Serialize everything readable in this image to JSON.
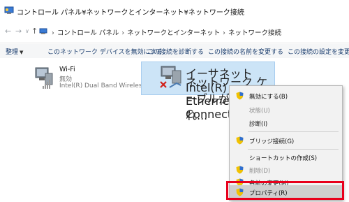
{
  "window": {
    "title": "コントロール パネル¥ネットワークとインターネット¥ネットワーク接続"
  },
  "nav": {
    "back": "←",
    "forward": "→",
    "recent": "∨",
    "up": "↑",
    "breadcrumbs": [
      "コントロール パネル",
      "ネットワークとインターネット",
      "ネットワーク接続"
    ],
    "separator": "›"
  },
  "toolbar": {
    "organize": "整理",
    "organize_caret": "▼",
    "disable": "このネットワーク デバイスを無効にする",
    "diagnose": "この接続を診断する",
    "rename": "この接続の名前を変更する",
    "settings": "この接続の設定を変更する"
  },
  "adapters": [
    {
      "name": "Wi-Fi",
      "status": "無効",
      "device": "Intel(R) Dual Band Wireless..."
    },
    {
      "name": "イーサネット",
      "status": "ネットワーク ケーブルが接続され...",
      "device": "Intel(R) Ethernet Connection..."
    }
  ],
  "context_menu": {
    "items": [
      {
        "label": "無効にする(B)",
        "shield": true,
        "disabled": false
      },
      {
        "label": "状態(U)",
        "shield": false,
        "disabled": true
      },
      {
        "label": "診断(I)",
        "shield": false,
        "disabled": false
      },
      {
        "label": "ブリッジ接続(G)",
        "shield": true,
        "disabled": false
      },
      {
        "label": "ショートカットの作成(S)",
        "shield": false,
        "disabled": false
      },
      {
        "label": "削除(D)",
        "shield": true,
        "disabled": true
      },
      {
        "label": "名前の変更(M)",
        "shield": true,
        "disabled": false
      },
      {
        "label": "プロパティ(R)",
        "shield": true,
        "disabled": false
      }
    ]
  },
  "colors": {
    "highlight_box": "#e8001c",
    "selection": "#cce4f7",
    "toolbar_text": "#1a3d6e"
  }
}
